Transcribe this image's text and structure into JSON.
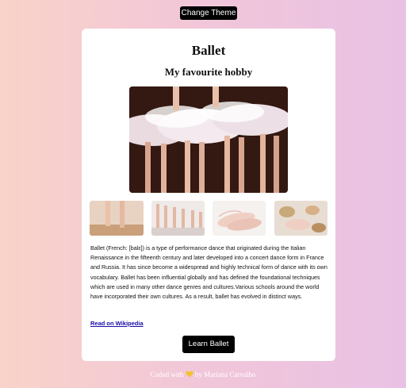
{
  "header": {
    "theme_button_label": "Change Theme"
  },
  "card": {
    "title": "Ballet",
    "subtitle": "My favourite hobby",
    "description": "Ballet (French: [balɛ]) is a type of performance dance that originated during the Italian Renaissance in the fifteenth century and later developed into a concert dance form in France and Russia. It has since become a widespread and highly technical form of dance with its own vocabulary. Ballet has been influential globally and has defined the foundational techniques which are used in many other dance genres and cultures.Various schools around the world have incorporated their own cultures. As a result, ballet has evolved in distinct ways.",
    "wiki_link_label": "Read on Wikipedia",
    "learn_button_label": "Learn Ballet"
  },
  "footer": {
    "coded_with": "Coded with",
    "heart_icon": "heart-icon",
    "author": "by Mariana Carvalho"
  },
  "colors": {
    "button": "#000000",
    "link": "#1a0dab",
    "heart": "#f2c230"
  }
}
